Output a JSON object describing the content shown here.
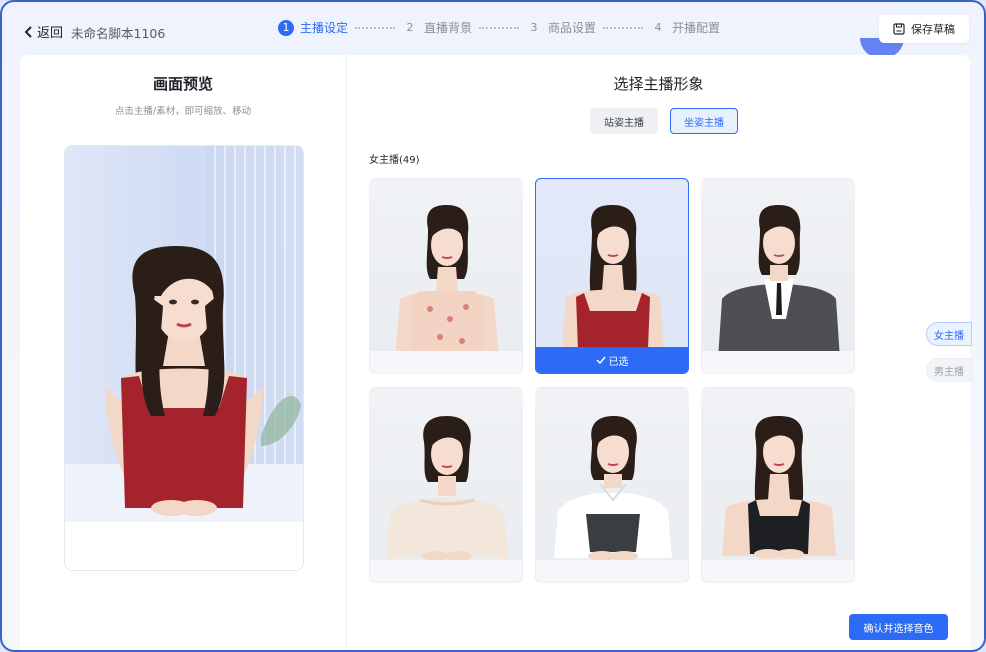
{
  "header": {
    "back_label": "返回",
    "script_name": "未命名脚本1106",
    "steps": [
      {
        "num": "1",
        "label": "主播设定"
      },
      {
        "num": "2",
        "label": "直播背景"
      },
      {
        "num": "3",
        "label": "商品设置"
      },
      {
        "num": "4",
        "label": "开播配置"
      }
    ],
    "active_step": 1,
    "save_label": "保存草稿"
  },
  "preview": {
    "title": "画面预览",
    "hint": "点击主播/素材，即可缩放、移动"
  },
  "selector": {
    "title": "选择主播形象",
    "pose_tabs": [
      "站姿主播",
      "坐姿主播"
    ],
    "active_pose": 1,
    "category_label": "女主播(49)",
    "cards": [
      {
        "name": "anchor-1",
        "outfit_color": "#f2d3c4",
        "selected": false
      },
      {
        "name": "anchor-2",
        "outfit_color": "#a5232c",
        "selected": true
      },
      {
        "name": "anchor-3",
        "outfit_color": "#4d4f55",
        "selected": false
      },
      {
        "name": "anchor-4",
        "outfit_color": "#f3e6da",
        "selected": false
      },
      {
        "name": "anchor-5",
        "outfit_color": "#3a3d42",
        "selected": false
      },
      {
        "name": "anchor-6",
        "outfit_color": "#1e1f22",
        "selected": false
      }
    ],
    "selected_label": "已选",
    "gender_tabs": [
      "女主播",
      "男主播"
    ],
    "active_gender": 0,
    "confirm_label": "确认并选择音色"
  },
  "colors": {
    "accent": "#2d6af6",
    "preview_dress": "#a5232c"
  }
}
